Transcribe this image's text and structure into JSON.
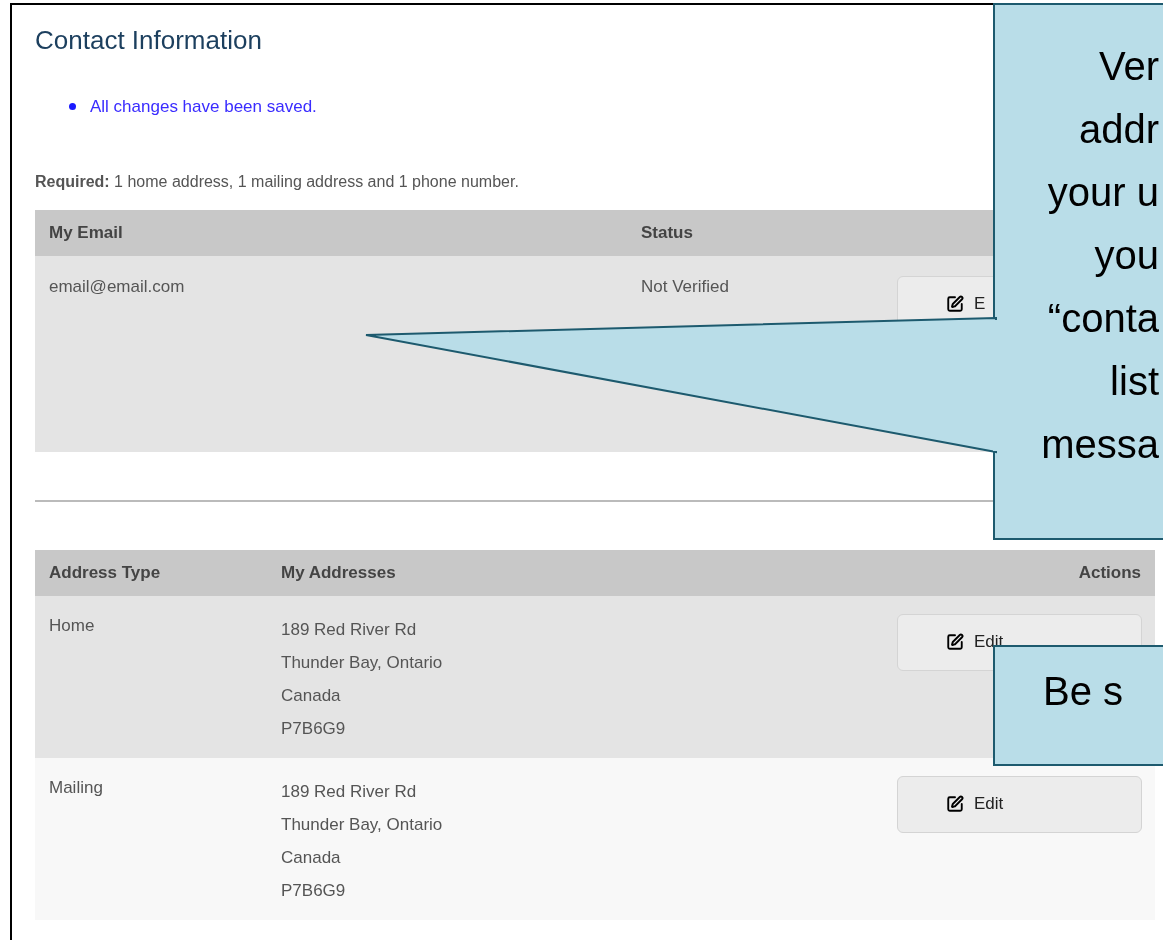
{
  "title": "Contact Information",
  "messages": [
    "All changes have been saved."
  ],
  "required": "**Required:** 1 home address, 1 mailing address and 1 phone number.",
  "email_table": {
    "columns": [
      "My Email",
      "Status"
    ],
    "rows": [
      {
        "email": "email@email.com",
        "status": "Not Verified",
        "button": "E"
      }
    ]
  },
  "address_table": {
    "columns": [
      "Address Type",
      "My Addresses",
      "Actions"
    ],
    "rows": [
      {
        "type": "Home",
        "address": [
          "189 Red River Rd",
          "Thunder Bay, Ontario",
          "Canada",
          "P7B6G9"
        ],
        "button": "Edit"
      },
      {
        "type": "Mailing",
        "address": [
          "189 Red River Rd",
          "Thunder Bay, Ontario",
          "Canada",
          "P7B6G9"
        ],
        "button": "Edit"
      }
    ]
  },
  "callouts": [
    {
      "kind": "pointer",
      "lines": [
        "Ver",
        "addr",
        "your u",
        "you",
        "“conta",
        "list",
        "messa"
      ]
    },
    {
      "kind": "plain",
      "lines": [
        "Be s"
      ]
    }
  ]
}
